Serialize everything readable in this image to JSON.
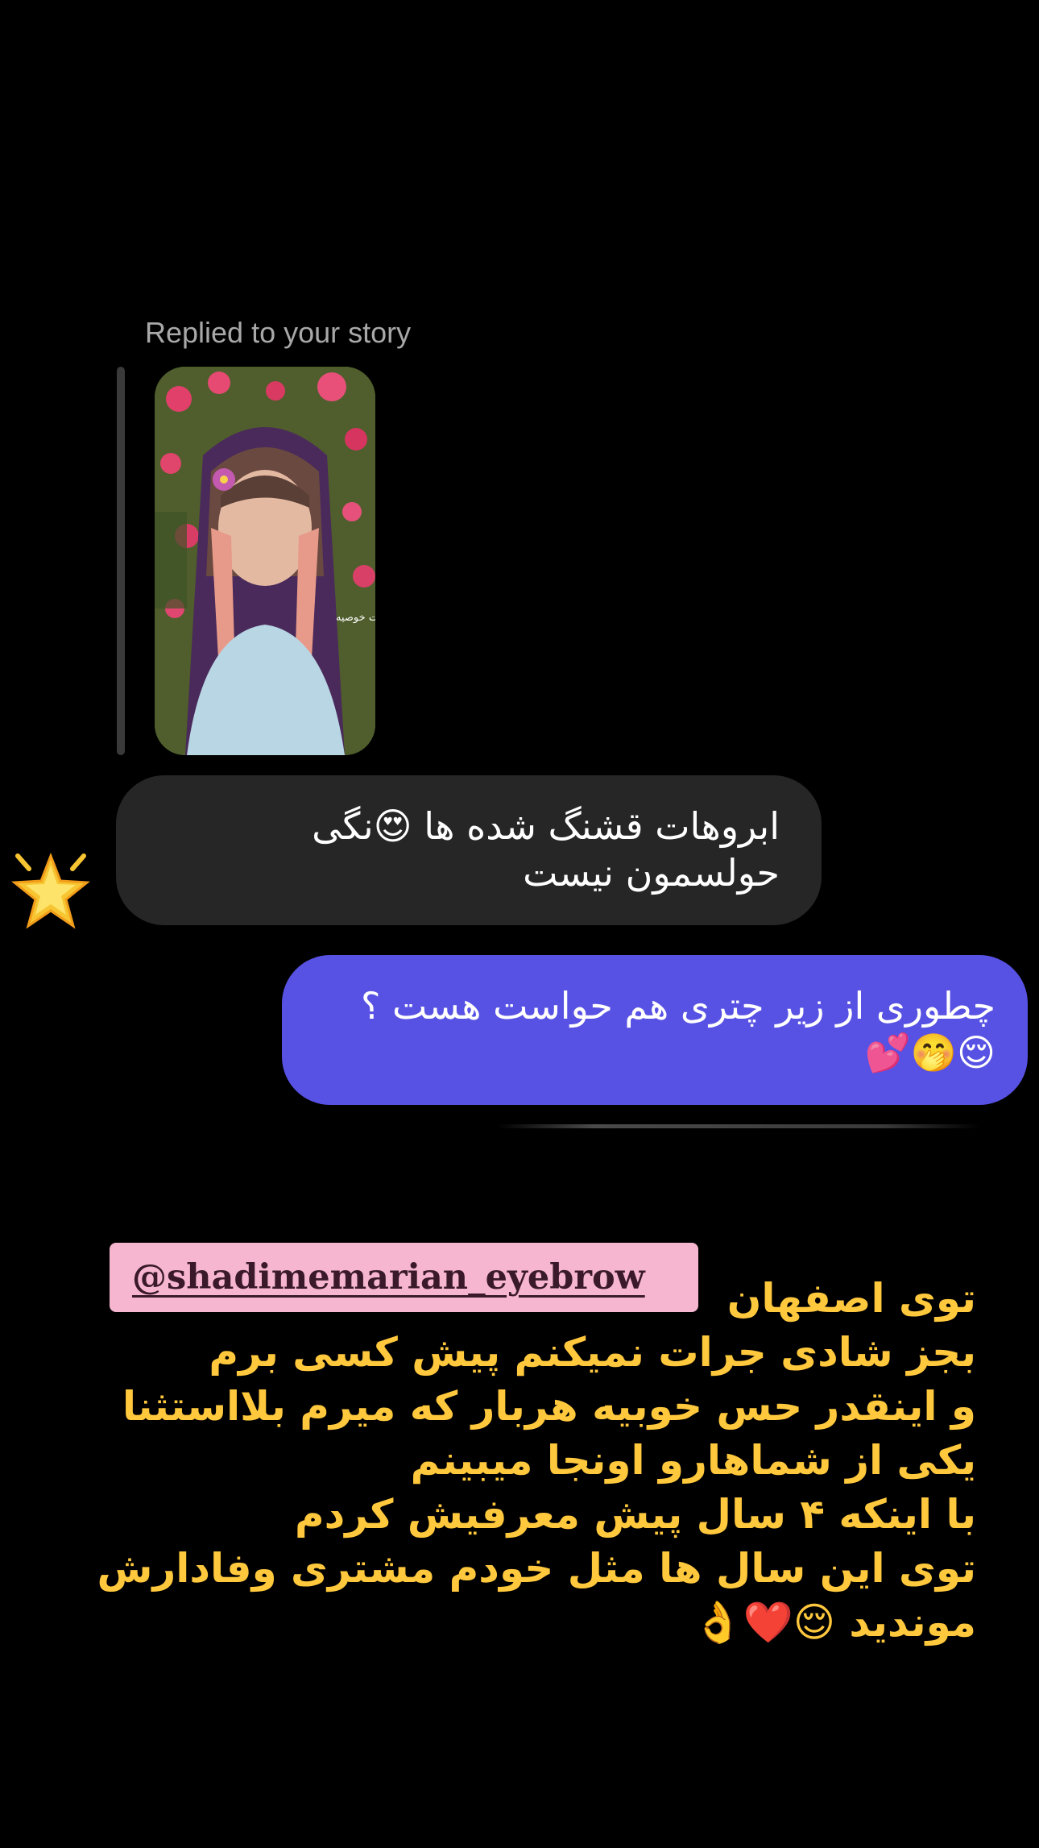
{
  "story_reply": {
    "label": "Replied to your story",
    "thumbnail_overlay_text": "آی نیست خوصیه"
  },
  "messages": [
    {
      "direction": "incoming",
      "text": "ابروهات قشنگ شده ها 😍نگی حولسمون نیست",
      "reaction": "🌟"
    },
    {
      "direction": "outgoing",
      "text": "چطوری از زیر چتری هم حواست هست ؟ 😌🤭💕"
    }
  ],
  "mention": {
    "handle": "@shadimemarian_eyebrow"
  },
  "caption": {
    "lines": [
      "توی اصفهان",
      "بجز شادی جرات نمیکنم پیش کسی برم",
      "و اینقدر حس خوبیه هربار که میرم بلااستثنا",
      "یکی از شماهارو اونجا میبینم",
      "با اینکه ۴ سال پیش معرفیش کردم",
      "توی این سال ها مثل خودم مشتری وفادارش",
      "موندید 😌❤️👌"
    ]
  },
  "colors": {
    "background": "#000000",
    "incoming_bubble": "#262626",
    "outgoing_bubble": "#5852e4",
    "caption_text": "#ffc83d",
    "mention_bg": "#f7b6cf",
    "reply_label": "#a8a8a8"
  }
}
